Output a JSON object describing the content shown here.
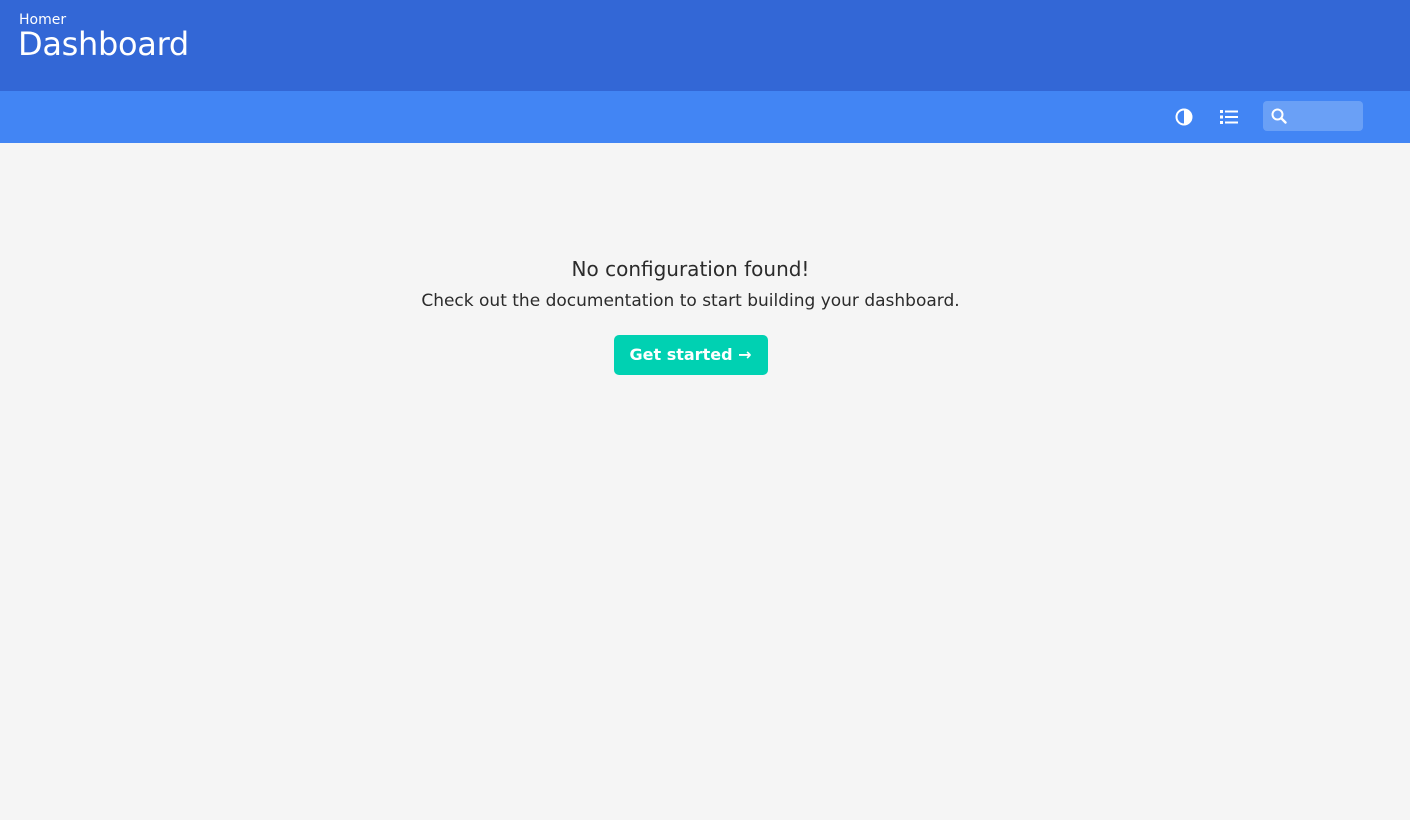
{
  "header": {
    "subtitle": "Homer",
    "title": "Dashboard",
    "background_color": "#3367d6"
  },
  "navbar": {
    "background_color": "#4285f4",
    "theme_toggle_icon": "half-circle-contrast-icon",
    "layout_toggle_icon": "list-icon",
    "search": {
      "icon": "search-icon",
      "value": "",
      "placeholder": ""
    }
  },
  "message": {
    "heading": "No configuration found!",
    "text": "Check out the documentation to start building your dashboard.",
    "button_label": "Get started →",
    "button_color": "#00d1b2"
  }
}
